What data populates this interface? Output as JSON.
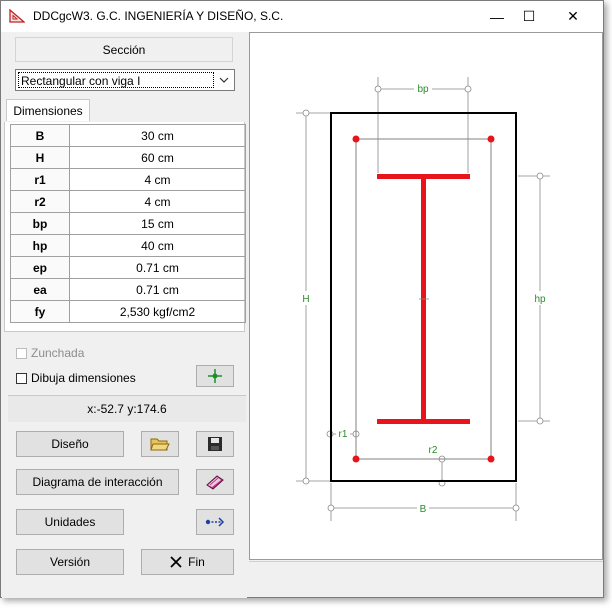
{
  "window": {
    "title": "DDCgcW3. G.C. INGENIERÍA Y DISEÑO, S.C.",
    "controls": {
      "minimize": "—",
      "maximize": "☐",
      "close": "✕"
    }
  },
  "section": {
    "button_label": "Sección",
    "selected_type": "Rectangular con viga I"
  },
  "tab": {
    "label": "Dimensiones"
  },
  "dimensions": [
    {
      "key": "B",
      "value": "30 cm"
    },
    {
      "key": "H",
      "value": "60 cm"
    },
    {
      "key": "r1",
      "value": "4 cm"
    },
    {
      "key": "r2",
      "value": "4 cm"
    },
    {
      "key": "bp",
      "value": "15 cm"
    },
    {
      "key": "hp",
      "value": "40 cm"
    },
    {
      "key": "ep",
      "value": "0.71 cm"
    },
    {
      "key": "ea",
      "value": "0.71 cm"
    },
    {
      "key": "fy",
      "value": "2,530 kgf/cm2"
    }
  ],
  "options": {
    "zunchada_label": "Zunchada",
    "zunchada_checked": false,
    "zunchada_enabled": false,
    "dibuja_label": "Dibuja dimensiones",
    "dibuja_checked": false
  },
  "coords": "x:-52.7 y:174.6",
  "buttons": {
    "diseno": "Diseño",
    "diagrama": "Diagrama de interacción",
    "unidades": "Unidades",
    "version": "Versión",
    "fin": "Fin"
  },
  "drawing": {
    "labels": {
      "bp": "bp",
      "H": "H",
      "hp": "hp",
      "r1": "r1",
      "r2": "r2",
      "B": "B"
    },
    "colors": {
      "outline": "#000000",
      "steel": "#e8141c",
      "rebar": "#e8141c",
      "dim": "#888888",
      "dim_text": "#2a8a2a",
      "stirrup": "#808080"
    }
  },
  "icons": {
    "app": "ruler-triangle-icon",
    "open": "open-folder-icon",
    "save": "floppy-disk-icon",
    "book": "book-icon",
    "units": "arrow-exchange-icon",
    "cross": "crosshair-icon",
    "close": "x-icon"
  }
}
